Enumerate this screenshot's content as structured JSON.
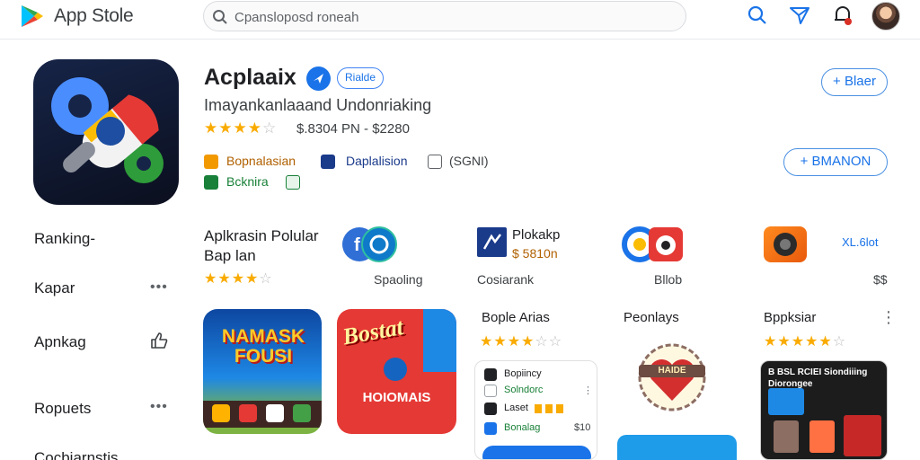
{
  "topbar": {
    "brand": "App Stole",
    "search_placeholder": "Cpansloposd roneah",
    "icons": [
      "google-play-logo",
      "search-icon",
      "send-icon",
      "notification-bell-icon",
      "avatar"
    ]
  },
  "app": {
    "title": "Acplaaix",
    "badge": "Rialde",
    "subtitle": "Imayankanlaaand Undonriaking",
    "rating_stars": 4,
    "price": "$.8304 PN - $2280",
    "meta": [
      {
        "label": "Bopnalasian",
        "color": "#f29900"
      },
      {
        "label": "Daplalision",
        "color": "#1a3a8a"
      },
      {
        "label": "(SGNI)",
        "color": "#3c4043"
      }
    ],
    "meta2": {
      "label": "Bcknira",
      "color": "#188038"
    },
    "btn_primary": "+ Blaer",
    "btn_secondary": "+ BMANON"
  },
  "sidebar": {
    "items": [
      {
        "label": "Ranking-"
      },
      {
        "label": "Kapar"
      },
      {
        "label": "Apnkag"
      },
      {
        "label": "Ropuets"
      },
      {
        "label": "Cocbiarnstis"
      }
    ]
  },
  "section": {
    "title": "Aplkrasin Polular Bap lan",
    "rating_stars": 4,
    "row1": [
      {
        "label": "Spaoling"
      },
      {
        "name": "Plokakp",
        "price": "$ 5810n",
        "sub": "Cosiarank"
      },
      {
        "label": "Bllob"
      },
      {
        "name": "XL.6lot",
        "sub": "$$"
      }
    ],
    "row2": [
      {
        "tile_title": "NAMASK FOUSI"
      },
      {
        "tile_title": "Bostat",
        "tile_caption": "HOIOMAIS"
      },
      {
        "title": "Bople Arias",
        "stars": 4,
        "list": [
          {
            "label": "Bopiincy",
            "sub": "Solndorc"
          },
          {
            "label": "Laset"
          },
          {
            "label": "Bonalag",
            "price": "$10"
          }
        ]
      },
      {
        "title": "Peonlays",
        "tile_caption": "HAIDE"
      },
      {
        "title": "Bppksiar",
        "stars": 5,
        "tile_caption": "B BSL RCIEI Siondiiing Diorongee"
      }
    ]
  },
  "colors": {
    "accent": "#1a73e8",
    "star": "#f9ab00"
  }
}
